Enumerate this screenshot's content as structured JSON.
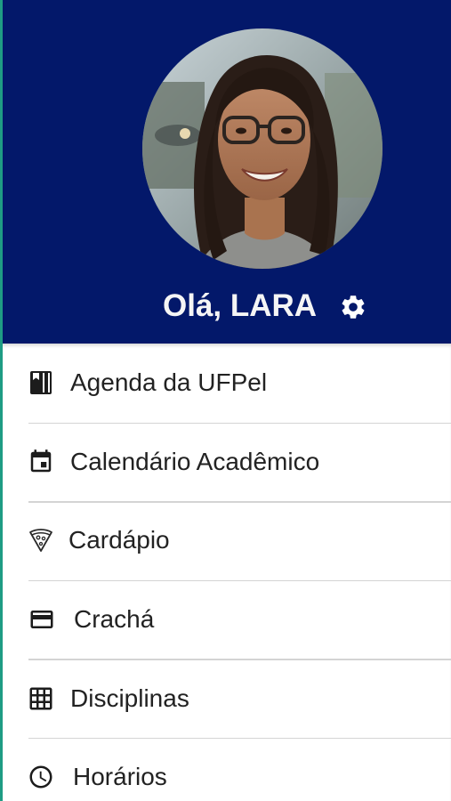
{
  "header": {
    "greeting": "Olá, LARA",
    "background_color": "#03186a",
    "avatar_icon": "user-photo",
    "settings_icon": "gear-icon"
  },
  "menu": {
    "items": [
      {
        "label": "Agenda da UFPel",
        "icon": "book-icon"
      },
      {
        "label": "Calendário Acadêmico",
        "icon": "calendar-icon"
      },
      {
        "label": "Cardápio",
        "icon": "pizza-icon"
      },
      {
        "label": "Crachá",
        "icon": "credit-card-icon"
      },
      {
        "label": "Disciplinas",
        "icon": "grid-icon"
      },
      {
        "label": "Horários",
        "icon": "clock-icon"
      }
    ]
  }
}
